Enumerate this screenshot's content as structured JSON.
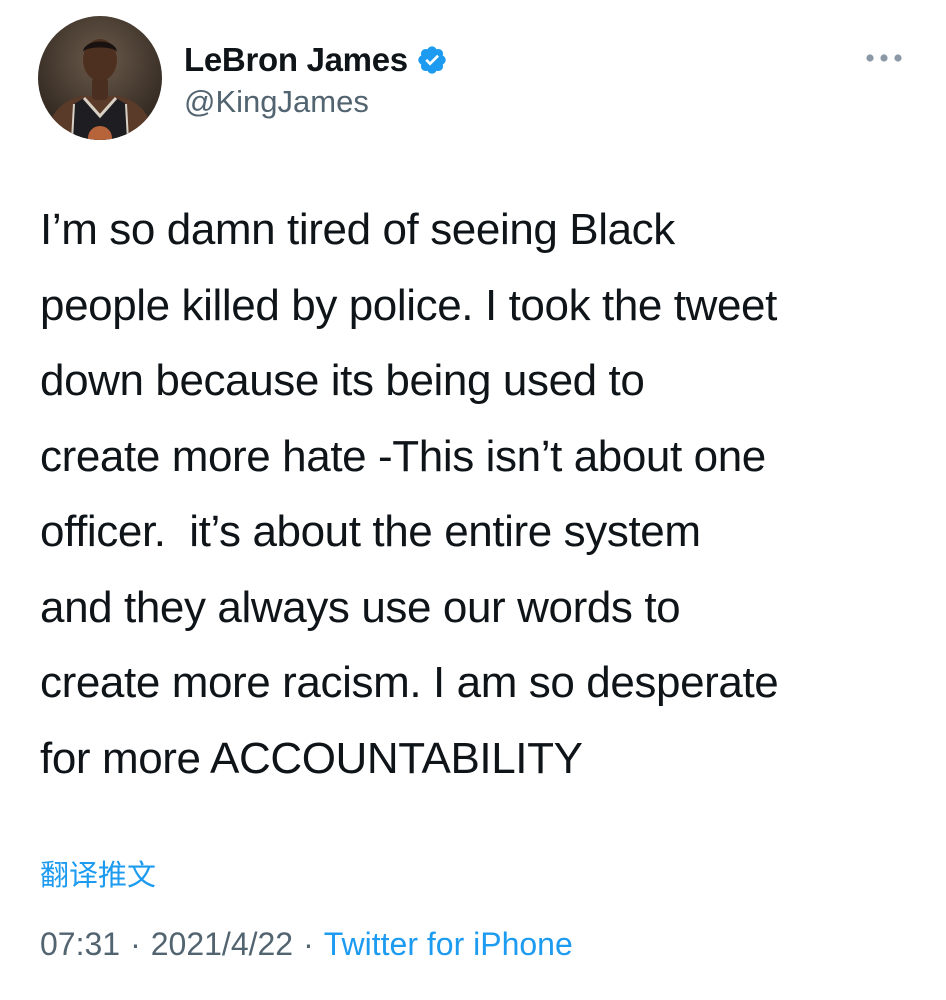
{
  "author": {
    "display_name": "LeBron James",
    "handle": "@KingJames",
    "verified": true,
    "verified_color": "#1d9bf0"
  },
  "tweet": {
    "text_lines": [
      "I’m so damn tired of seeing Black",
      "people killed by police. I took the tweet",
      "down because its being used to",
      "create more hate -This isn’t about one",
      "officer.  it’s about the entire system",
      "and they always use our words to",
      "create more racism. I am so desperate",
      "for more ACCOUNTABILITY"
    ],
    "translate_label": "翻译推文"
  },
  "meta": {
    "time": "07:31",
    "separator": "·",
    "date": "2021/4/22",
    "source": "Twitter for iPhone"
  },
  "icons": {
    "more": "more-horizontal-icon",
    "verified": "verified-badge-icon"
  },
  "colors": {
    "text": "#0f1419",
    "secondary": "#536471",
    "link": "#1d9bf0"
  }
}
